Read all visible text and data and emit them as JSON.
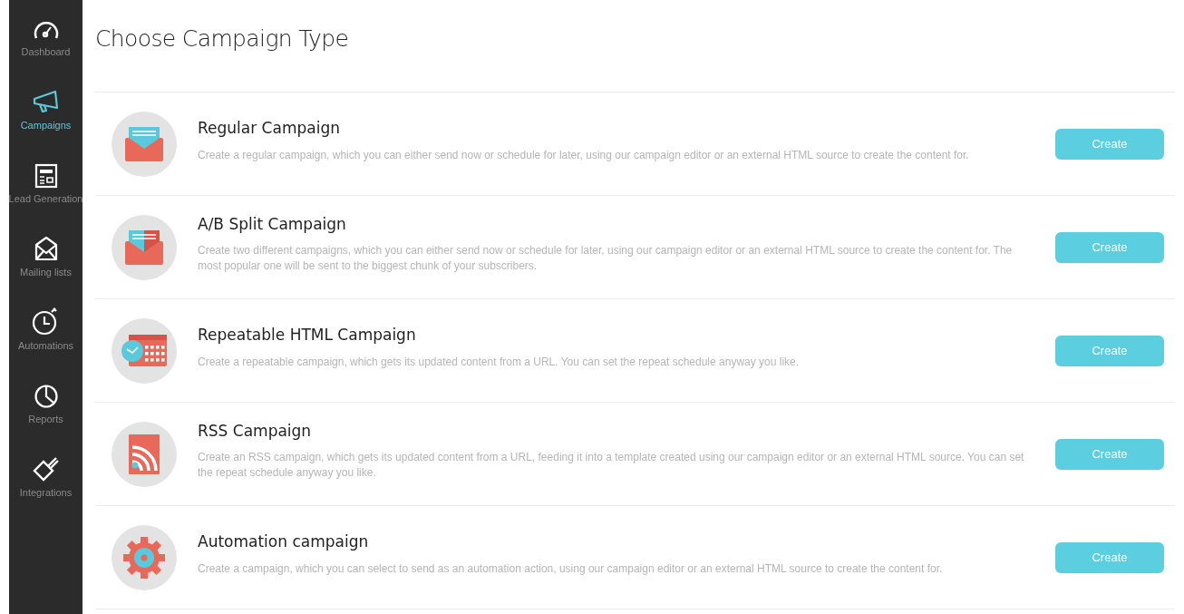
{
  "sidebar": {
    "items": [
      {
        "kind": "gauge",
        "label": "Dashboard",
        "selected": false
      },
      {
        "kind": "megaphone",
        "label": "Campaigns",
        "selected": true
      },
      {
        "kind": "form",
        "label": "Lead Generation",
        "selected": false
      },
      {
        "kind": "envelope",
        "label": "Mailing lists",
        "selected": false
      },
      {
        "kind": "stopwatch",
        "label": "Automations",
        "selected": false
      },
      {
        "kind": "pie",
        "label": "Reports",
        "selected": false
      },
      {
        "kind": "plug",
        "label": "Integrations",
        "selected": false
      }
    ]
  },
  "page": {
    "title": "Choose Campaign Type"
  },
  "campaign_types": [
    {
      "kind": "regular",
      "title": "Regular Campaign",
      "description": "Create a regular campaign, which you can either send now or schedule for later, using our campaign editor or an external HTML source to create the content for.",
      "button": "Create"
    },
    {
      "kind": "ab_split",
      "title": "A/B Split Campaign",
      "description": "Create two different campaigns, which you can either send now or schedule for later, using our campaign editor or an external HTML source to create the content for. The most popular one will be sent to the biggest chunk of your subscribers.",
      "button": "Create"
    },
    {
      "kind": "repeatable",
      "title": "Repeatable HTML Campaign",
      "description": "Create a repeatable campaign, which gets its updated content from a URL. You can set the repeat schedule anyway you like.",
      "button": "Create"
    },
    {
      "kind": "rss",
      "title": "RSS Campaign",
      "description": "Create an RSS campaign, which gets its updated content from a URL, feeding it into a template created using our campaign editor or an external HTML source. You can set the repeat schedule anyway you like.",
      "button": "Create"
    },
    {
      "kind": "automation",
      "title": "Automation campaign",
      "description": "Create a campaign, which you can select to send as an automation action, using our campaign editor or an external HTML source to create the content for.",
      "button": "Create"
    }
  ]
}
